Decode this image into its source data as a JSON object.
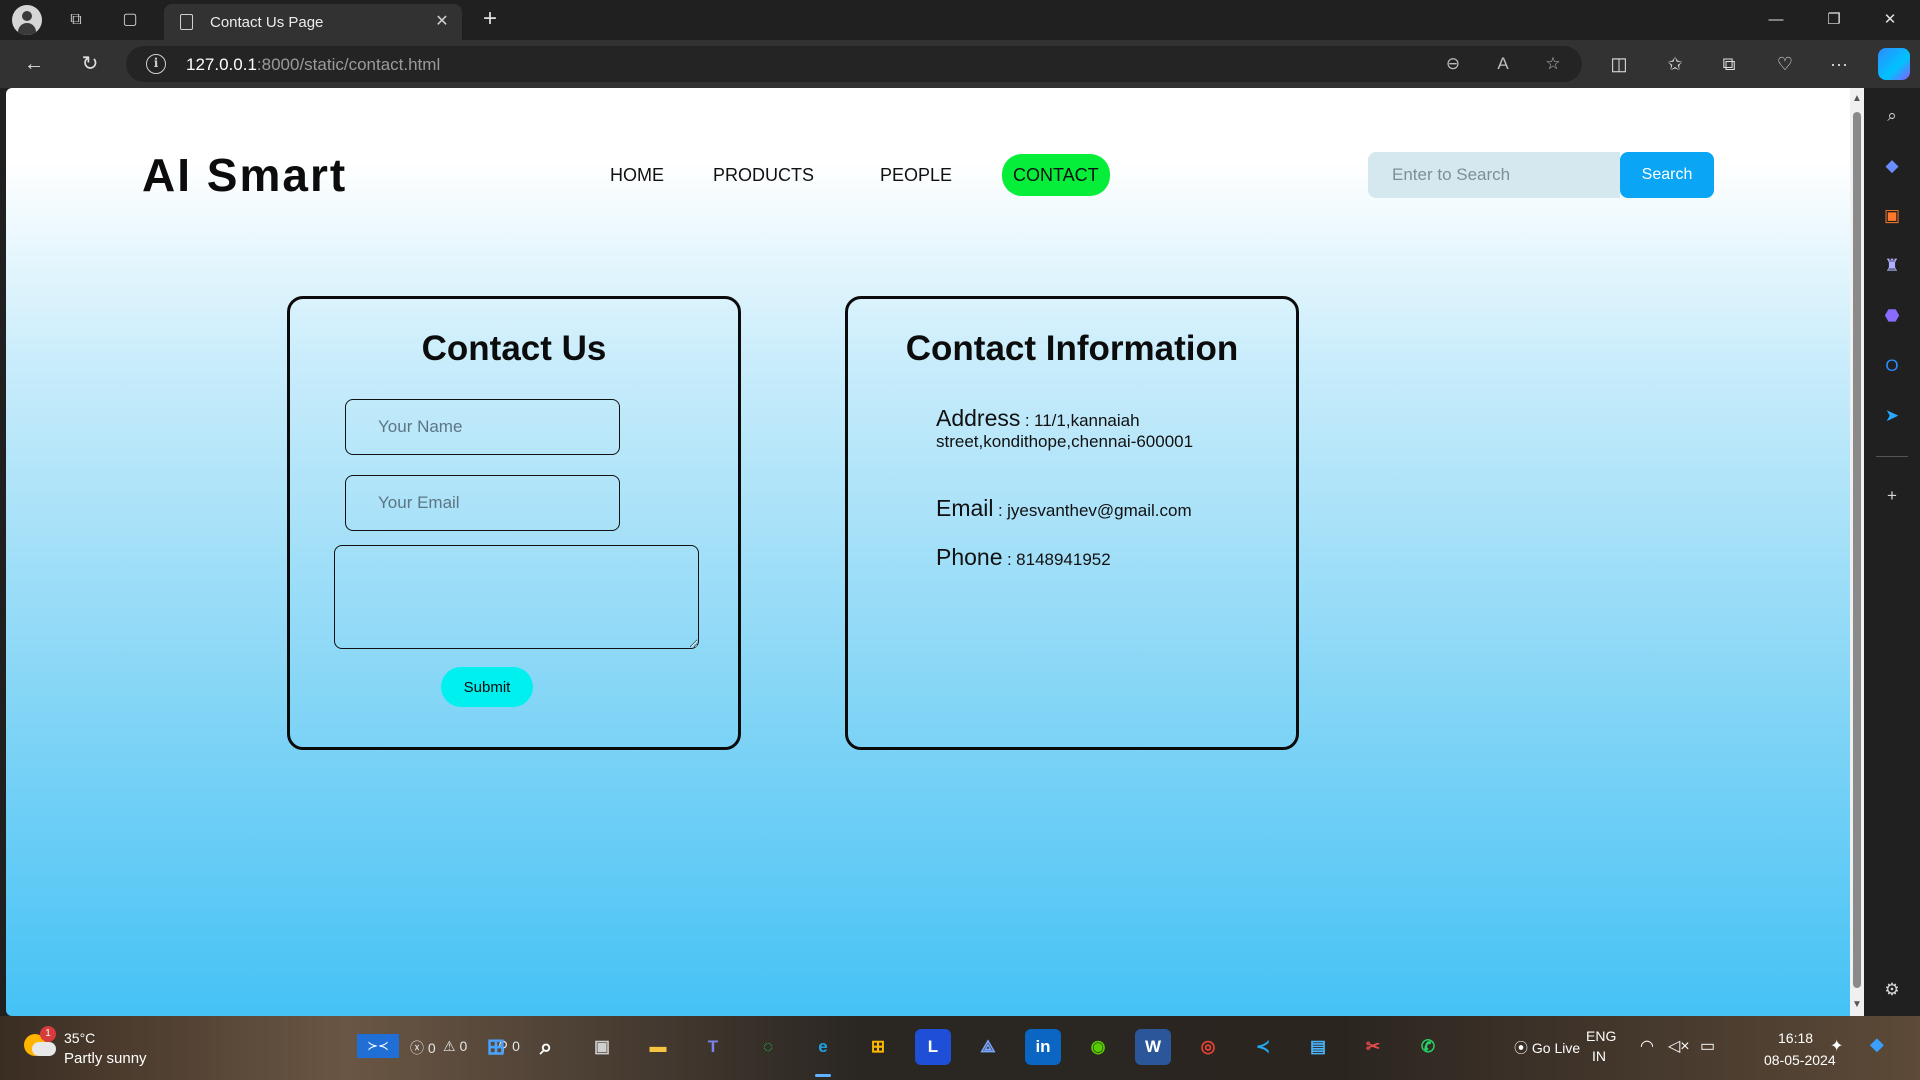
{
  "browser": {
    "tab_title": "Contact Us Page",
    "new_tab_symbol": "+",
    "url_host": "127.0.0.1",
    "url_rest": ":8000/static/contact.html",
    "tab_close_symbol": "✕",
    "minimize_symbol": "—",
    "restore_symbol": "❐",
    "close_symbol": "✕",
    "back_symbol": "←",
    "refresh_symbol": "↻",
    "more_symbol": "···"
  },
  "site": {
    "logo": "AI Smart",
    "nav": {
      "home": "HOME",
      "products": "PRODUCTS",
      "people": "PEOPLE",
      "contact": "CONTACT"
    },
    "search": {
      "placeholder": "Enter to Search",
      "button": "Search"
    }
  },
  "contact_form": {
    "title": "Contact Us",
    "name_placeholder": "Your Name",
    "email_placeholder": "Your Email",
    "message_value": "",
    "submit": "Submit"
  },
  "contact_info": {
    "title": "Contact Information",
    "address_label": "Address",
    "address_value": "11/1,kannaiah street,kondithope,chennai-600001",
    "email_label": "Email",
    "email_value": "jyesvanthev@gmail.com",
    "phone_label": "Phone",
    "phone_value": "8148941952",
    "separator": ":"
  },
  "taskbar": {
    "weather_temp": "35°C",
    "weather_desc": "Partly sunny",
    "weather_badge": "1",
    "errors": "0",
    "warnings": "0",
    "ports": "0",
    "go_live": "Go Live",
    "lang_top": "ENG",
    "lang_bottom": "IN",
    "time": "16:18",
    "date": "08-05-2024"
  },
  "colors": {
    "active_nav": "#07ee3a",
    "search_button": "#0aa5f5",
    "submit_button": "#00f0f0",
    "page_gradient_end": "#45c2f5"
  }
}
